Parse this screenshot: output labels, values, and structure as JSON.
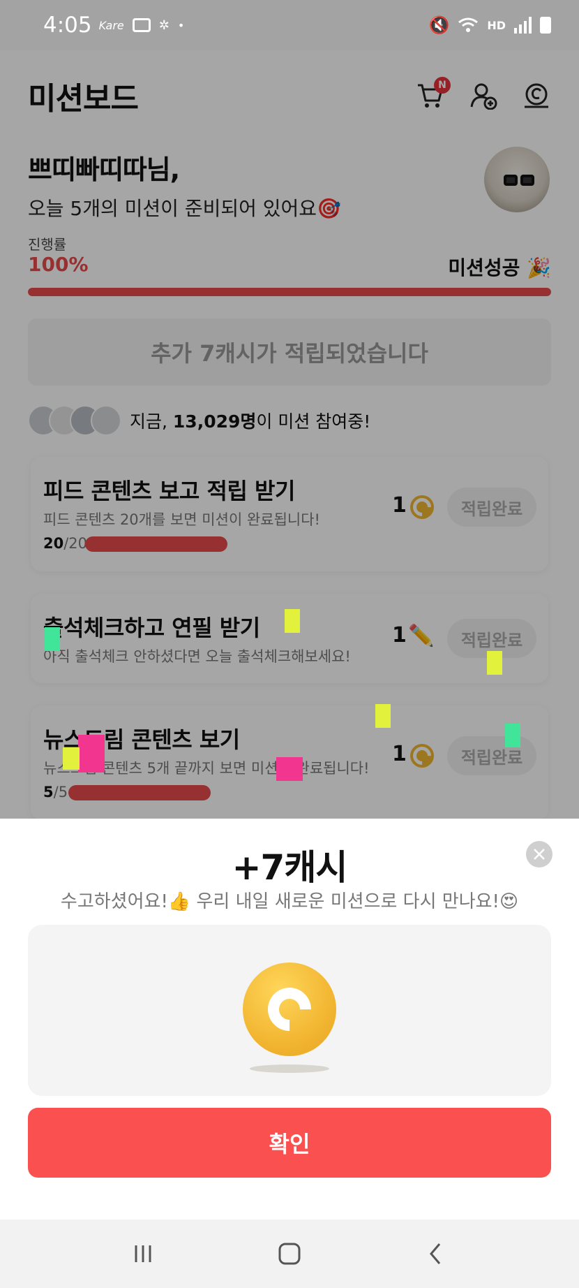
{
  "status_bar": {
    "time": "4:05",
    "left_icons": [
      "kare-icon",
      "notification-box-icon",
      "grid-dots-icon",
      "dot-icon"
    ],
    "right_icons": [
      "mute-icon",
      "wifi-icon",
      "hd-voice-icon",
      "signal-icon",
      "battery-icon"
    ],
    "hd_label": "HD"
  },
  "header": {
    "title": "미션보드",
    "cart_badge": "N",
    "icons": [
      "cart-icon",
      "add-friend-icon",
      "cash-icon"
    ]
  },
  "greeting": {
    "name": "쁘띠빠띠따님,",
    "subtitle": "오늘 5개의 미션이 준비되어 있어요🎯"
  },
  "progress": {
    "label": "진행률",
    "value_text": "100%",
    "value": 1.0,
    "status": "미션성공 🎉"
  },
  "banner": {
    "text": "추가 7캐시가 적립되었습니다"
  },
  "participants": {
    "prefix": "지금, ",
    "count": "13,029명",
    "suffix": "이 미션 참여중!"
  },
  "missions": [
    {
      "title": "피드 콘텐츠 보고 적립 받기",
      "desc": "피드 콘텐츠 20개를 보면 미션이 완료됩니다!",
      "count_done": "20",
      "count_total": "/20",
      "progress": 1.0,
      "reward": "1",
      "reward_icon": "cash-coin-icon",
      "button": "적립완료"
    },
    {
      "title": "출석체크하고 연필 받기",
      "desc": "아직 출석체크 안하셨다면 오늘 출석체크해보세요!",
      "reward": "1",
      "reward_icon": "pencil-icon",
      "button": "적립완료"
    },
    {
      "title": "뉴스드림 콘텐츠 보기",
      "desc": "뉴스드림 콘텐츠 5개 끝까지 보면 미션이 완료됩니다!",
      "count_done": "5",
      "count_total": "/5",
      "progress": 1.0,
      "reward": "1",
      "reward_icon": "cash-coin-icon",
      "button": "적립완료"
    }
  ],
  "sheet": {
    "amount": "+7캐시",
    "message": "수고하셨어요!👍 우리 내일 새로운 미션으로 다시 만나요!😍",
    "confirm": "확인"
  },
  "colors": {
    "accent": "#e84a4a",
    "confirm_button": "#fb5050",
    "coin": "#f2b632",
    "dim_overlay": "rgba(0,0,0,0.35)"
  },
  "navbar": {
    "icons": [
      "recent-apps-icon",
      "home-icon",
      "back-icon"
    ]
  }
}
